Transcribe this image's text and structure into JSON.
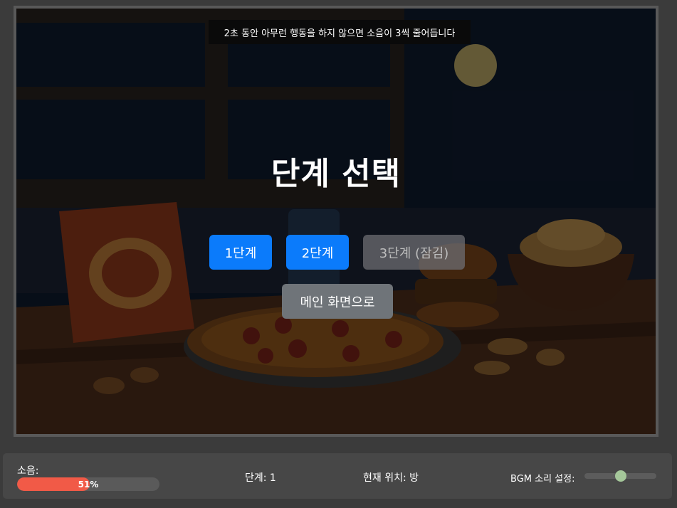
{
  "notice": "2초 동안 아무런 행동을 하지 않으면 소음이 3씩 줄어듭니다",
  "title": "단계 선택",
  "buttons": {
    "stage1": "1단계",
    "stage2": "2단계",
    "stage3": "3단계 (잠김)",
    "main_menu": "메인 화면으로"
  },
  "hud": {
    "noise_label": "소음:",
    "noise_percent_text": "51%",
    "noise_value": 51,
    "stage_text": "단계: 1",
    "location_text": "현재 위치: 방",
    "bgm_label": "BGM 소리 설정:",
    "bgm_volume": 0.5
  },
  "colors": {
    "primary_button": "#0b7bfb",
    "noise_fill": "#f15a47",
    "slider_knob": "#a5c79a"
  }
}
